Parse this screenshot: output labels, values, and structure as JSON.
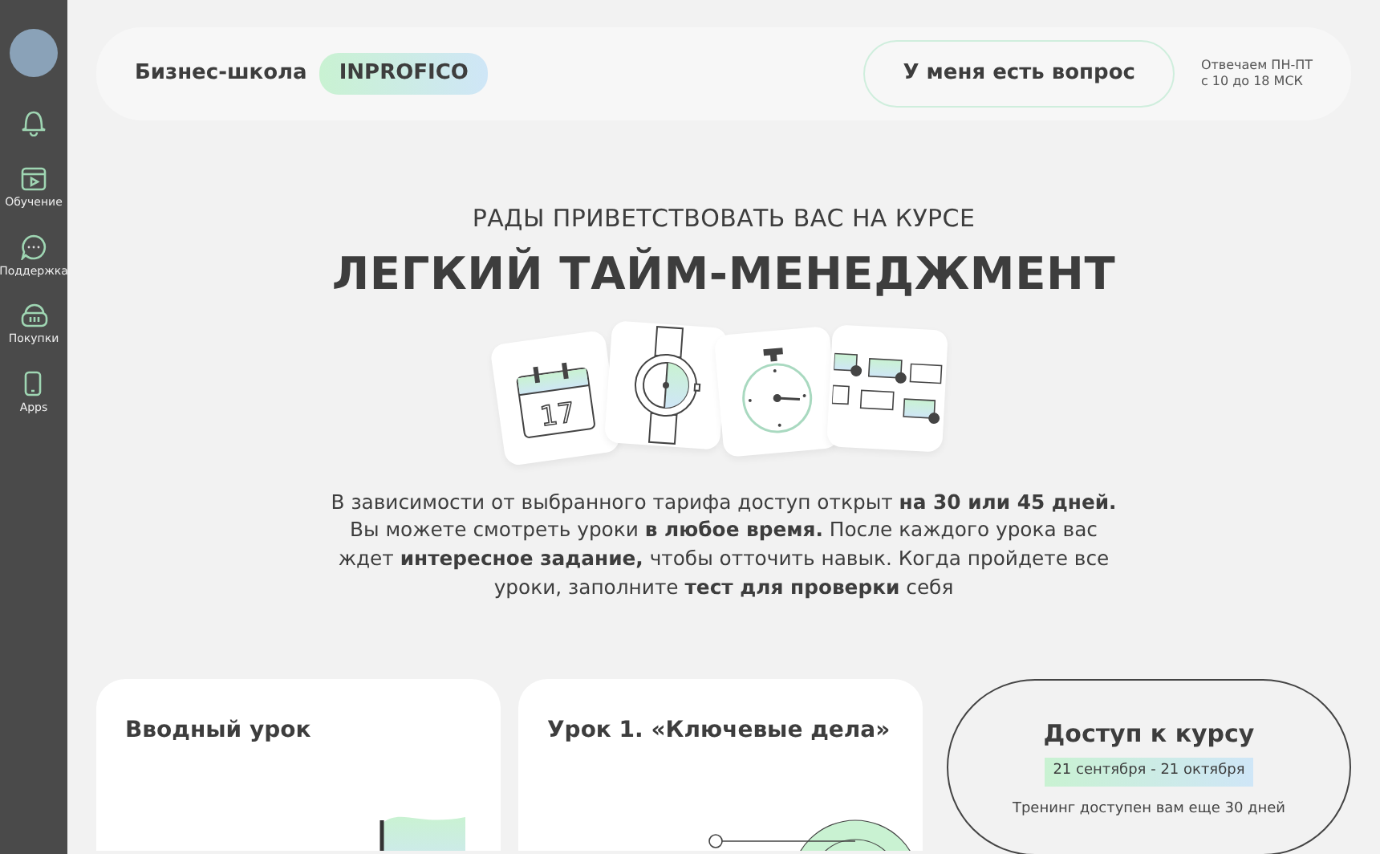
{
  "sidebar": {
    "items": [
      {
        "kind": "video",
        "label": "Обучение"
      },
      {
        "kind": "chat",
        "label": "Поддержка"
      },
      {
        "kind": "basket",
        "label": "Покупки"
      },
      {
        "kind": "phone",
        "label": "Apps"
      }
    ]
  },
  "header": {
    "school": "Бизнес-школа",
    "brand": "INPROFICO",
    "question_button": "У меня есть вопрос",
    "hours": [
      "Отвечаем ПН-ПТ",
      "с 10 до 18 МСК"
    ]
  },
  "hero": {
    "subtitle": "РАДЫ ПРИВЕТСТВОВАТЬ ВАС НА КУРСЕ",
    "title": "ЛЕГКИЙ ТАЙМ-МЕНЕДЖМЕНТ",
    "calendar_day": "17",
    "description": "В зависимости от выбранного тарифа доступ открыт **на 30 или 45 дней.** Вы можете смотреть уроки **в любое время.** После каждого урока вас ждет **интересное задание,** чтобы отточить навык. Когда пройдете все уроки, заполните **тест для проверки** себя"
  },
  "lessons": [
    {
      "kind": "flag",
      "title": "Вводный урок"
    },
    {
      "kind": "target",
      "title": "Урок 1. «Ключевые дела»"
    }
  ],
  "access": {
    "title": "Доступ к курсу",
    "dates": "21 сентября - 21 октября",
    "note": "Тренинг доступен вам еще 30 дней"
  }
}
